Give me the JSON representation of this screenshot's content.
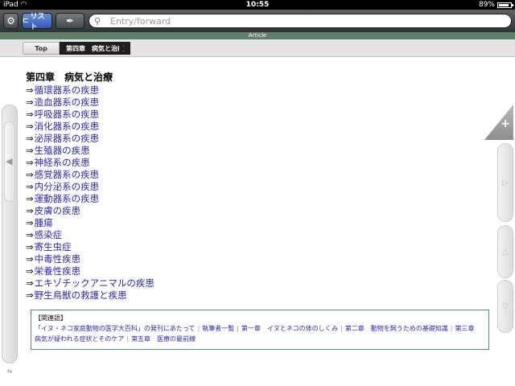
{
  "status": {
    "device": "iPad",
    "time": "10:55",
    "battery": "89%",
    "battery_level": 0.89
  },
  "toolbar": {
    "list_label": "リスト",
    "search_placeholder": "Entry/forward"
  },
  "article_label": "Article",
  "breadcrumb": {
    "top": "Top",
    "current": "第四章　病気と治療"
  },
  "chapter_title": "第四章　病気と治療",
  "arrow": "⇒",
  "links": [
    "循環器系の疾患",
    "造血器系の疾患",
    "呼吸器系の疾患",
    "消化器系の疾患",
    "泌尿器系の疾患",
    "生殖器の疾患",
    "神経系の疾患",
    "感覚器系の疾患",
    "内分泌系の疾患",
    "運動器系の疾患",
    "皮膚の疾患",
    "腫瘍",
    "感染症",
    "寄生虫症",
    "中毒性疾患",
    "栄養性疾患",
    "エキゾチックアニマルの疾患",
    "野生鳥獣の救護と疾患"
  ],
  "related": {
    "heading": "【関連語】",
    "items": [
      "「イヌ・ネコ家庭動物の医学大百科」の発刊にあたって",
      "執筆者一覧",
      "第一章　イヌとネコの体のしくみ",
      "第二章　動物を飼うための基礎知識",
      "第三章　病気が疑われる症状とそのケア",
      "第五章　医療の最前線"
    ],
    "separator": "|"
  }
}
